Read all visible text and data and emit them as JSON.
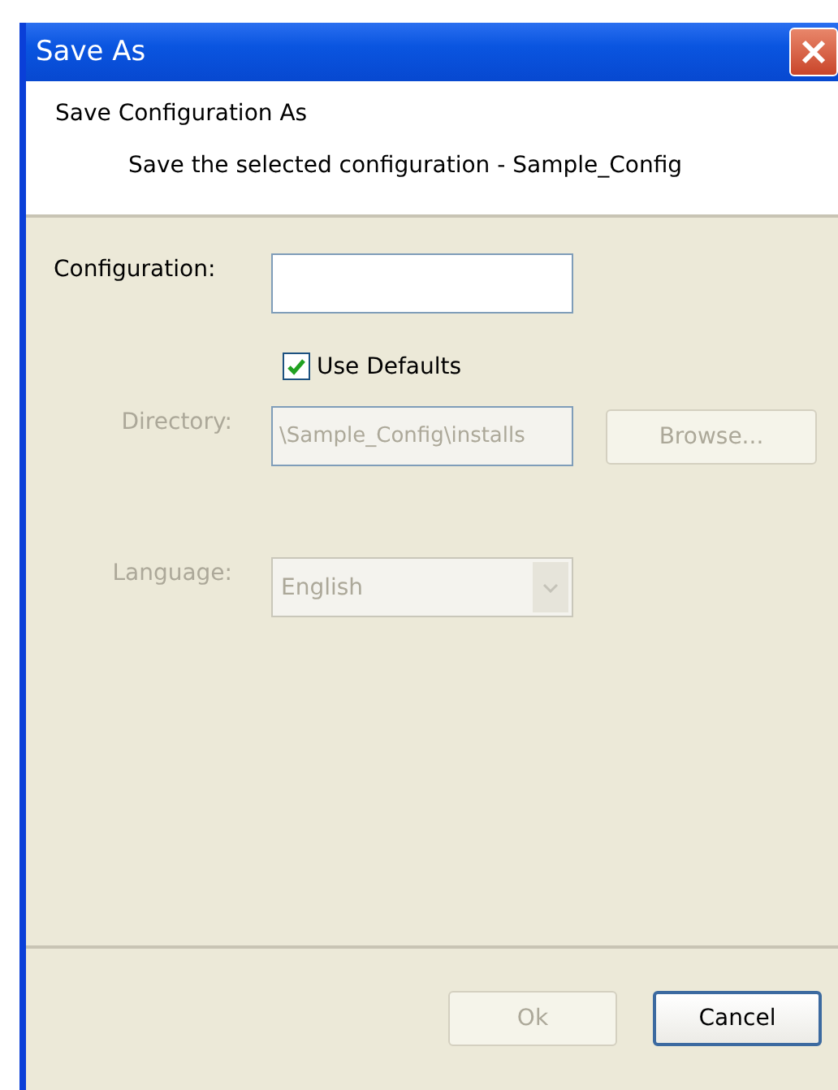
{
  "window": {
    "title": "Save As"
  },
  "header": {
    "title": "Save Configuration As",
    "subtitle": "Save the selected configuration - Sample_Config"
  },
  "form": {
    "configuration": {
      "label": "Configuration:",
      "disabled": false
    },
    "use_defaults": {
      "label": "Use Defaults",
      "checked": true,
      "disabled": false
    },
    "directory": {
      "label": "Directory:",
      "value": "\\Sample_Config\\installs",
      "disabled": true,
      "button": {
        "label": "Browse...",
        "disabled": true
      }
    },
    "language": {
      "label": "Language:",
      "value": "English",
      "disabled": true
    }
  },
  "buttons": [
    {
      "label": "Ok",
      "disabled": true,
      "default": false
    },
    {
      "label": "Cancel",
      "disabled": false,
      "default": true
    }
  ]
}
